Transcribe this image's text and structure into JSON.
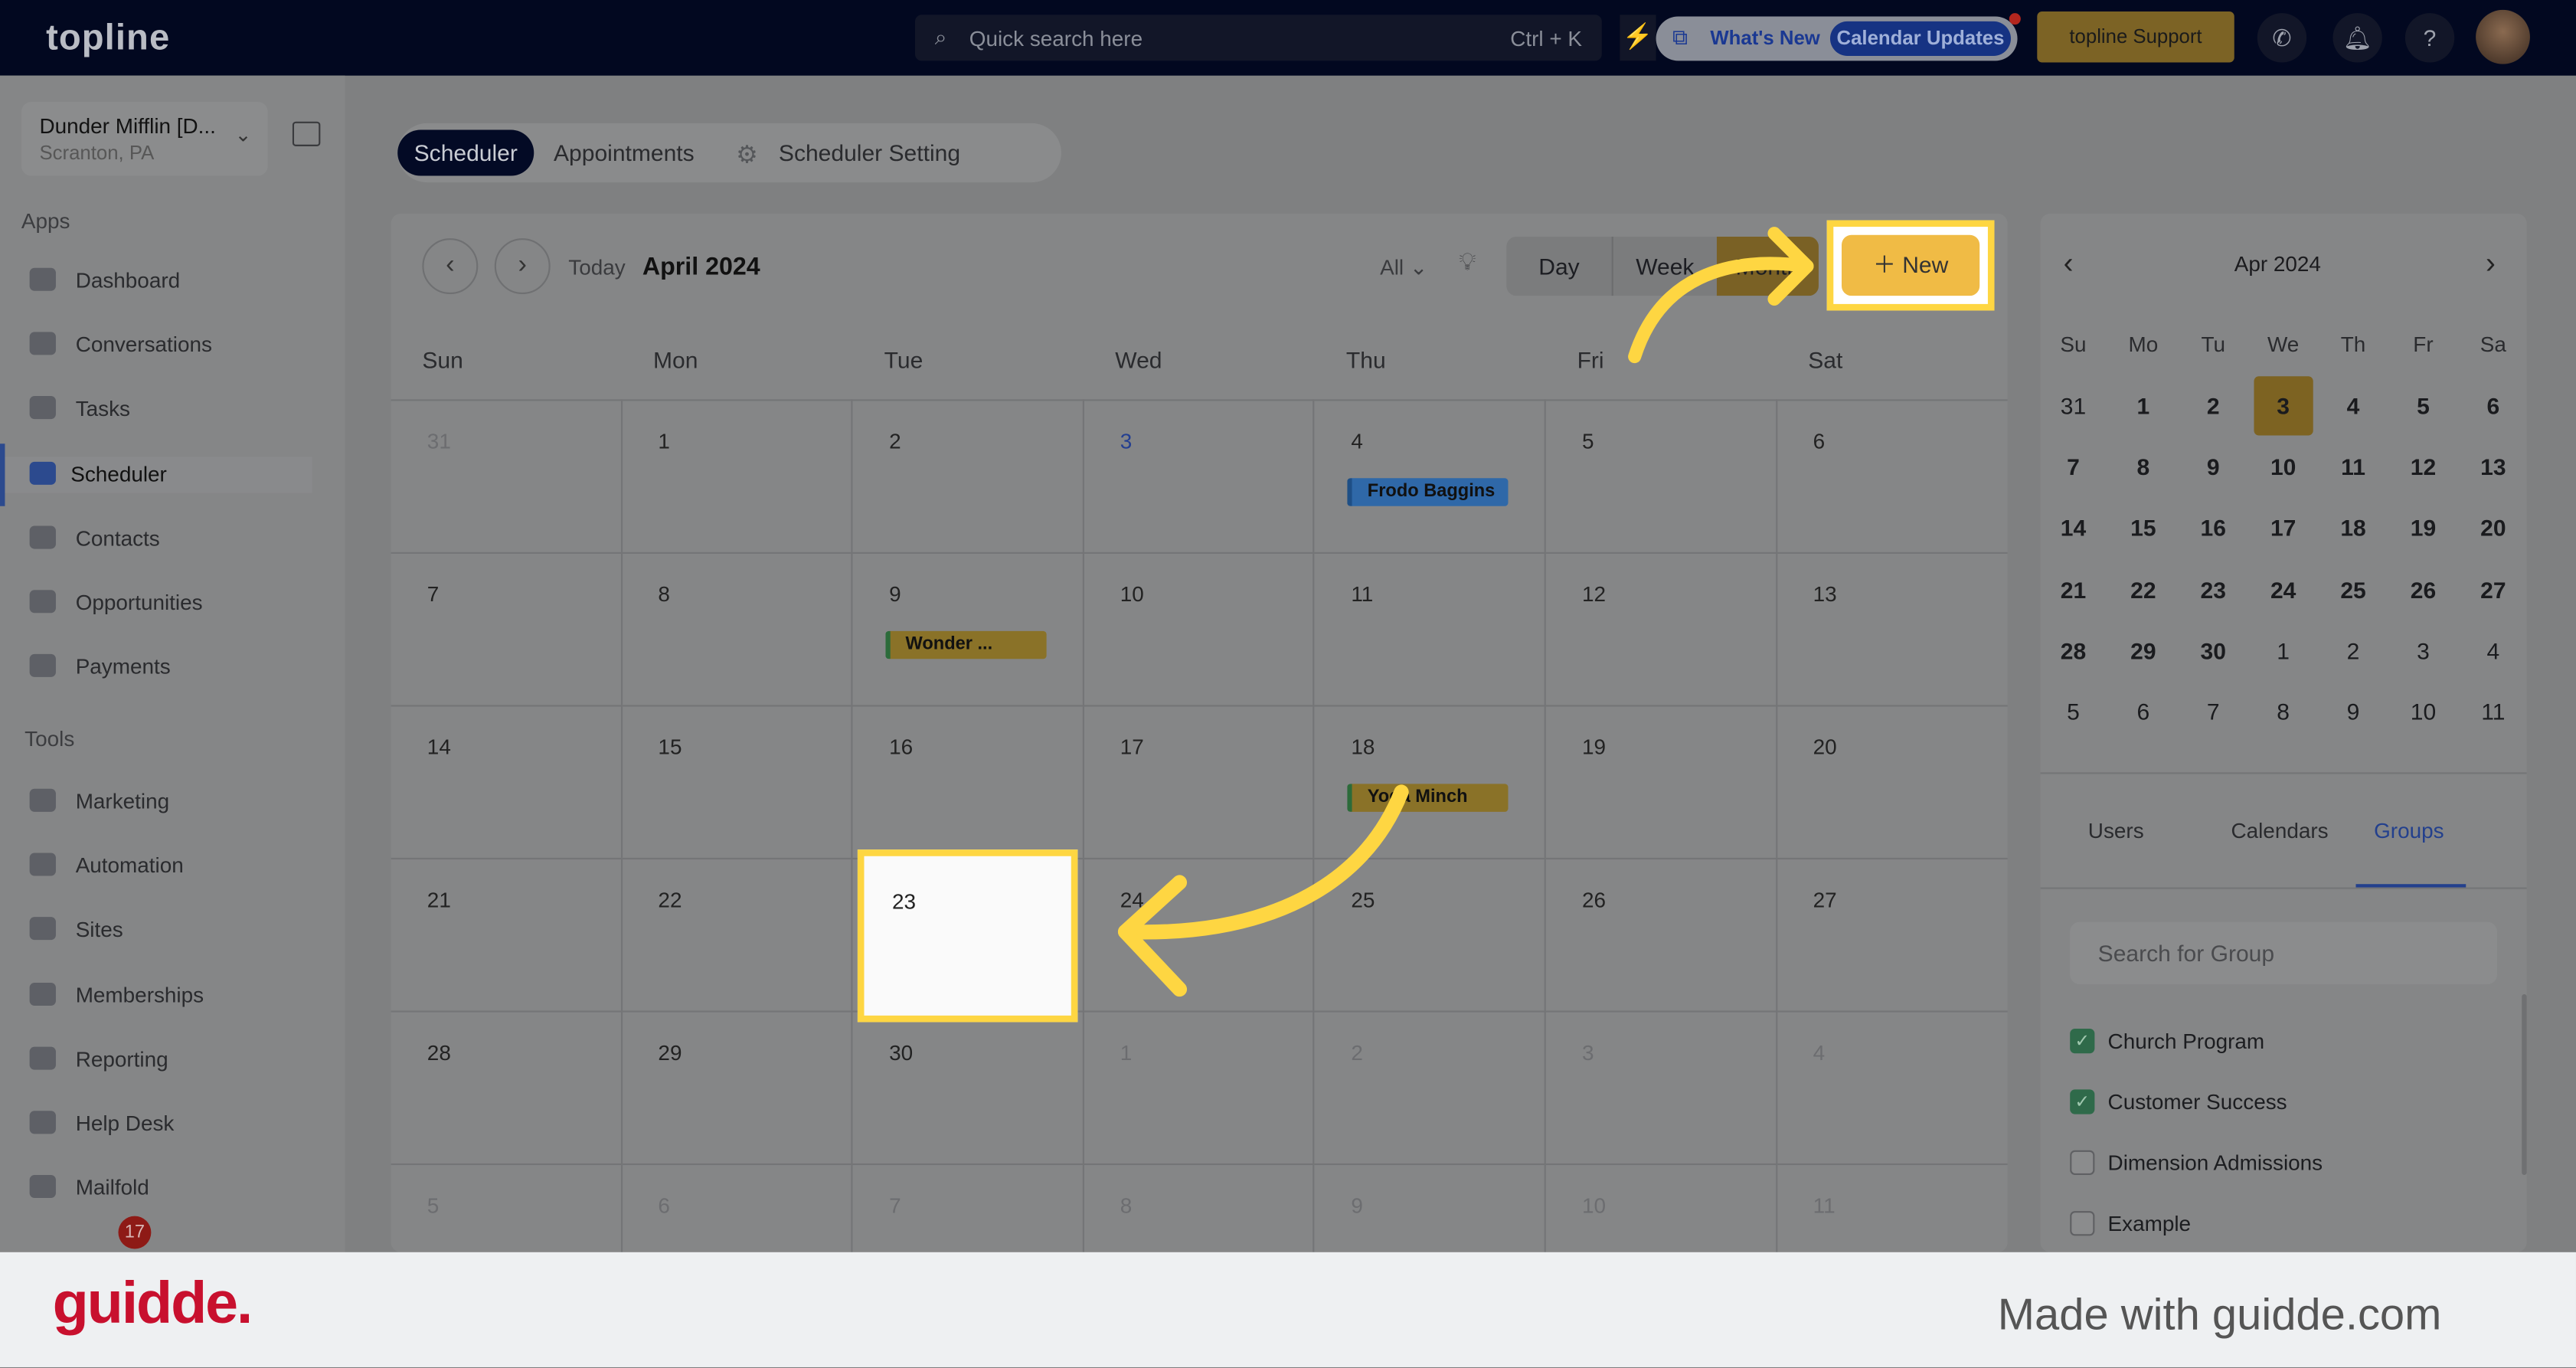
{
  "topbar": {
    "logo": "topline",
    "search_placeholder": "Quick search here",
    "search_shortcut": "Ctrl + K",
    "whats_new": "What's New",
    "calendar_updates": "Calendar Updates",
    "support": "topline Support"
  },
  "account": {
    "name": "Dunder Mifflin [D...",
    "location": "Scranton, PA"
  },
  "sidebar": {
    "apps_label": "Apps",
    "apps": [
      {
        "label": "Dashboard"
      },
      {
        "label": "Conversations"
      },
      {
        "label": "Tasks"
      },
      {
        "label": "Scheduler",
        "active": true
      },
      {
        "label": "Contacts"
      },
      {
        "label": "Opportunities"
      },
      {
        "label": "Payments"
      }
    ],
    "tools_label": "Tools",
    "tools": [
      {
        "label": "Marketing"
      },
      {
        "label": "Automation"
      },
      {
        "label": "Sites"
      },
      {
        "label": "Memberships"
      },
      {
        "label": "Reporting"
      },
      {
        "label": "Help Desk"
      },
      {
        "label": "Mailfold"
      }
    ],
    "badge": "17"
  },
  "tabs": [
    {
      "label": "Scheduler",
      "active": true
    },
    {
      "label": "Appointments"
    },
    {
      "label": "Scheduler Setting"
    }
  ],
  "toolbar": {
    "today": "Today",
    "month": "April 2024",
    "filter": "All",
    "views": [
      "Day",
      "Week",
      "Month"
    ],
    "active_view": "Month",
    "new": "New"
  },
  "calendar": {
    "weekdays": [
      "Sun",
      "Mon",
      "Tue",
      "Wed",
      "Thu",
      "Fri",
      "Sat"
    ],
    "weeks": [
      [
        "31",
        "1",
        "2",
        "3",
        "4",
        "5",
        "6"
      ],
      [
        "7",
        "8",
        "9",
        "10",
        "11",
        "12",
        "13"
      ],
      [
        "14",
        "15",
        "16",
        "17",
        "18",
        "19",
        "20"
      ],
      [
        "21",
        "22",
        "23",
        "24",
        "25",
        "26",
        "27"
      ],
      [
        "28",
        "29",
        "30",
        "1",
        "2",
        "3",
        "4"
      ],
      [
        "5",
        "6",
        "7",
        "8",
        "9",
        "10",
        "11"
      ]
    ],
    "events": [
      {
        "week": 0,
        "day": 4,
        "title": "Frodo Baggins",
        "color": "#2f68a8",
        "bar": "#1e4f86"
      },
      {
        "week": 1,
        "day": 2,
        "title": "Wonder ...",
        "color": "#8a7228",
        "bar": "#2c6b3a"
      },
      {
        "week": 2,
        "day": 4,
        "title": "Yoda Minch",
        "color": "#8a7228",
        "bar": "#2c6b3a"
      }
    ]
  },
  "mini_calendar": {
    "title": "Apr 2024",
    "weekdays": [
      "Su",
      "Mo",
      "Tu",
      "We",
      "Th",
      "Fr",
      "Sa"
    ],
    "weeks": [
      [
        "31",
        "1",
        "2",
        "3",
        "4",
        "5",
        "6"
      ],
      [
        "7",
        "8",
        "9",
        "10",
        "11",
        "12",
        "13"
      ],
      [
        "14",
        "15",
        "16",
        "17",
        "18",
        "19",
        "20"
      ],
      [
        "21",
        "22",
        "23",
        "24",
        "25",
        "26",
        "27"
      ],
      [
        "28",
        "29",
        "30",
        "1",
        "2",
        "3",
        "4"
      ],
      [
        "5",
        "6",
        "7",
        "8",
        "9",
        "10",
        "11"
      ]
    ],
    "selected": "3"
  },
  "right_tabs": [
    {
      "label": "Users"
    },
    {
      "label": "Calendars"
    },
    {
      "label": "Groups",
      "active": true
    }
  ],
  "groups": {
    "search_placeholder": "Search for Group",
    "items": [
      {
        "label": "Church Program",
        "checked": true
      },
      {
        "label": "Customer Success",
        "checked": true
      },
      {
        "label": "Dimension Admissions",
        "checked": false
      },
      {
        "label": "Example",
        "checked": false
      }
    ]
  },
  "footer": {
    "logo": "guidde.",
    "made_with": "Made with guidde.com"
  },
  "colors": {
    "highlight": "#fed642",
    "accent": "#f0bb45"
  }
}
